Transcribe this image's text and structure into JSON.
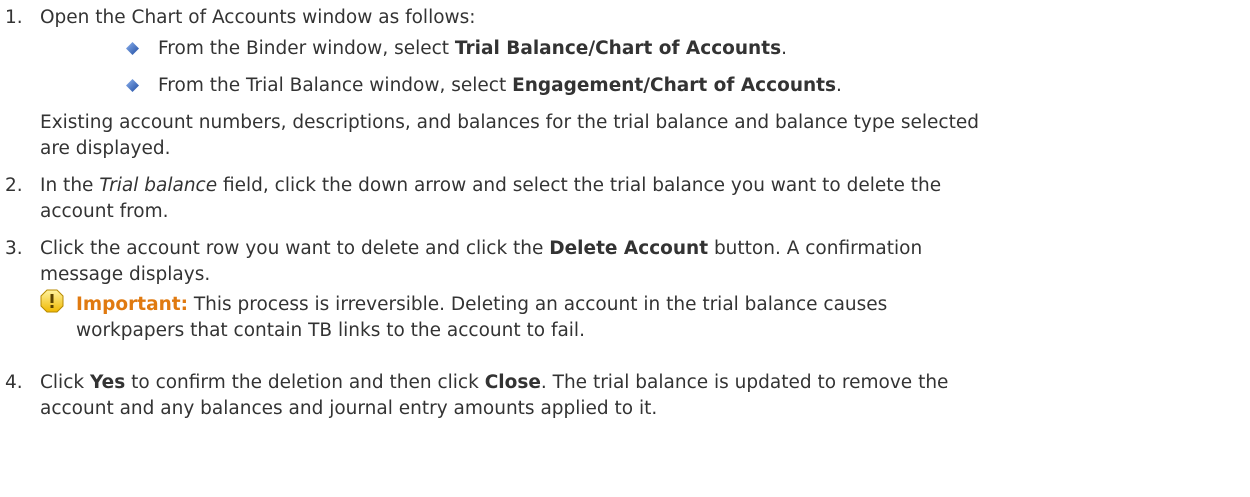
{
  "step1": {
    "number": "1.",
    "text": "Open the Chart of Accounts window as follows:",
    "bullets": [
      {
        "pre": "From the Binder window, select ",
        "bold": "Trial Balance/Chart of Accounts",
        "post": "."
      },
      {
        "pre": "From the Trial Balance window, select ",
        "bold": "Engagement/Chart of Accounts",
        "post": "."
      }
    ],
    "note_line1": "Existing account numbers, descriptions, and balances for the trial balance and balance type selected",
    "note_line2": "are displayed."
  },
  "step2": {
    "number": "2.",
    "pre": "In the ",
    "italic": "Trial balance",
    "post": " field, click the down arrow and select the trial balance you want to delete the",
    "line2": "account from."
  },
  "step3": {
    "number": "3.",
    "pre": "Click the account row you want to delete and click the ",
    "bold": "Delete Account",
    "post": " button. A confirmation",
    "line2": "message displays.",
    "important_label": "Important:",
    "important_text": " This process is irreversible. Deleting an account in the trial balance causes",
    "important_line2": "workpapers that contain TB links to the account to fail."
  },
  "step4": {
    "number": "4.",
    "pre": "Click ",
    "bold1": "Yes",
    "mid": " to confirm the deletion and then click ",
    "bold2": "Close",
    "post": ". The trial balance is updated to remove the",
    "line2": "account and any balances and journal entry amounts applied to it."
  },
  "colors": {
    "text": "#333333",
    "important": "#e07a10",
    "bullet": "#2f5fb3",
    "warning_icon": "#f2c200"
  }
}
